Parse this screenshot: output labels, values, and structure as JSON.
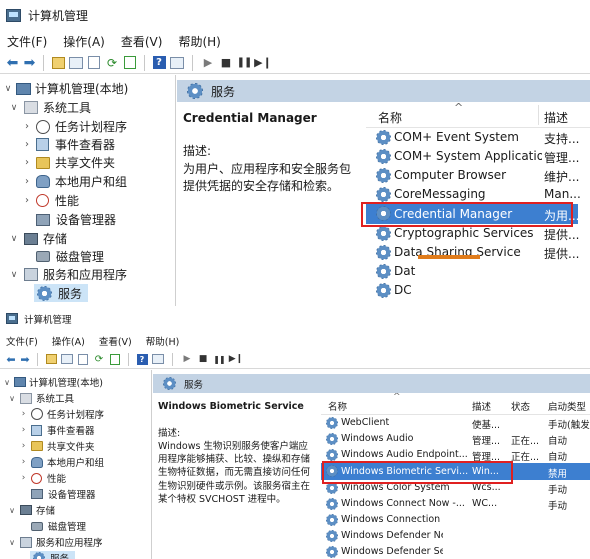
{
  "colors": {
    "header_band": "#c3d3e4",
    "selection": "#3d7fd0",
    "highlight_box": "#e02020"
  },
  "window1": {
    "title": "计算机管理",
    "menu": [
      "文件(F)",
      "操作(A)",
      "查看(V)",
      "帮助(H)"
    ],
    "tree": [
      {
        "label": "计算机管理(本地)",
        "icon": "computer-icon"
      },
      {
        "label": "系统工具",
        "icon": "tools-icon"
      },
      {
        "label": "任务计划程序",
        "icon": "clock-icon"
      },
      {
        "label": "事件查看器",
        "icon": "event-log-icon"
      },
      {
        "label": "共享文件夹",
        "icon": "folder-icon"
      },
      {
        "label": "本地用户和组",
        "icon": "users-icon"
      },
      {
        "label": "性能",
        "icon": "performance-icon"
      },
      {
        "label": "设备管理器",
        "icon": "device-manager-icon"
      },
      {
        "label": "存储",
        "icon": "storage-icon"
      },
      {
        "label": "磁盘管理",
        "icon": "disk-icon"
      },
      {
        "label": "服务和应用程序",
        "icon": "services-apps-icon"
      },
      {
        "label": "服务",
        "icon": "gear-icon"
      }
    ],
    "band_title": "服务",
    "detail": {
      "service_name": "Credential Manager",
      "desc_label": "描述:",
      "desc_text": "为用户、应用程序和安全服务包提供凭据的安全存储和检索。"
    },
    "columns": {
      "name": "名称",
      "description": "描述"
    },
    "rows": [
      {
        "name": "COM+ Event System",
        "desc": "支持..."
      },
      {
        "name": "COM+ System Application",
        "desc": "管理..."
      },
      {
        "name": "Computer Browser",
        "desc": "维护..."
      },
      {
        "name": "CoreMessaging",
        "desc": "Man..."
      },
      {
        "name": "Credential Manager",
        "desc": "为用..."
      },
      {
        "name": "Cryptographic Services",
        "desc": "提供..."
      },
      {
        "name": "Data Sharing Service",
        "desc": "提供..."
      },
      {
        "name": "Dat",
        "desc": ""
      },
      {
        "name": "DC",
        "desc": ""
      }
    ]
  },
  "window2": {
    "title": "计算机管理",
    "menu": [
      "文件(F)",
      "操作(A)",
      "查看(V)",
      "帮助(H)"
    ],
    "tree": [
      {
        "label": "计算机管理(本地)",
        "icon": "computer-icon"
      },
      {
        "label": "系统工具",
        "icon": "tools-icon"
      },
      {
        "label": "任务计划程序",
        "icon": "clock-icon"
      },
      {
        "label": "事件查看器",
        "icon": "event-log-icon"
      },
      {
        "label": "共享文件夹",
        "icon": "folder-icon"
      },
      {
        "label": "本地用户和组",
        "icon": "users-icon"
      },
      {
        "label": "性能",
        "icon": "performance-icon"
      },
      {
        "label": "设备管理器",
        "icon": "device-manager-icon"
      },
      {
        "label": "存储",
        "icon": "storage-icon"
      },
      {
        "label": "磁盘管理",
        "icon": "disk-icon"
      },
      {
        "label": "服务和应用程序",
        "icon": "services-apps-icon"
      },
      {
        "label": "服务",
        "icon": "gear-icon"
      }
    ],
    "band_title": "服务",
    "detail": {
      "service_name": "Windows Biometric Service",
      "desc_label": "描述:",
      "desc_text": "Windows 生物识别服务使客户端应用程序能够捕获、比较、操纵和存储生物特征数据，而无需直接访问任何生物识别硬件或示例。该服务宿主在某个特权 SVCHOST 进程中。"
    },
    "columns": {
      "name": "名称",
      "description": "描述",
      "status": "状态",
      "startup": "启动类型"
    },
    "rows": [
      {
        "name": "WebClient",
        "desc": "使基...",
        "status": "",
        "startup": "手动(触发"
      },
      {
        "name": "Windows Audio",
        "desc": "管理...",
        "status": "正在...",
        "startup": "自动"
      },
      {
        "name": "Windows Audio Endpoint...",
        "desc": "管理...",
        "status": "正在...",
        "startup": "自动"
      },
      {
        "name": "Windows Biometric Servi...",
        "desc": "Win...",
        "status": "",
        "startup": "禁用"
      },
      {
        "name": "Windows Color System",
        "desc": "Wcs...",
        "status": "",
        "startup": "手动"
      },
      {
        "name": "Windows Connect Now -...",
        "desc": "WC...",
        "status": "",
        "startup": "手动"
      },
      {
        "name": "Windows Connection M",
        "desc": "",
        "status": "",
        "startup": ""
      },
      {
        "name": "Windows Defender Ne",
        "desc": "",
        "status": "",
        "startup": ""
      },
      {
        "name": "Windows Defender Se",
        "desc": "",
        "status": "",
        "startup": ""
      }
    ]
  }
}
